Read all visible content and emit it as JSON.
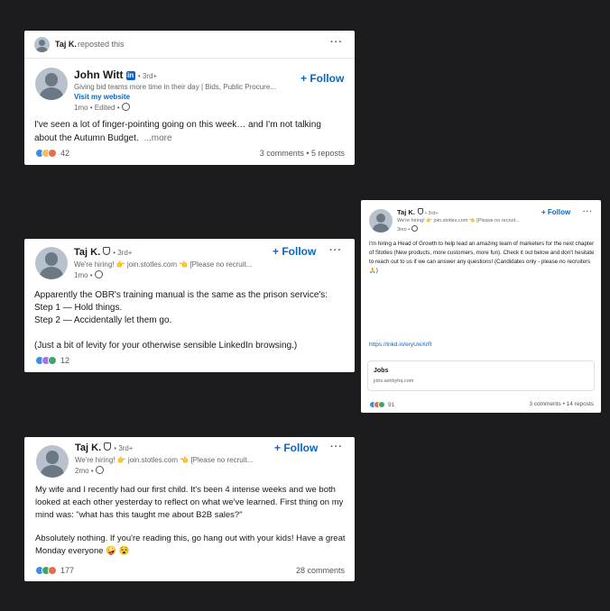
{
  "post1": {
    "repost_user": "Taj K.",
    "repost_text": "reposted this",
    "more": "···",
    "author": "John Witt",
    "degree": "• 3rd+",
    "headline": "Giving bid teams more time in their day | Bids, Public Procure...",
    "website": "Visit my website",
    "meta": "1mo • Edited •",
    "follow": "+ Follow",
    "body": "I've seen a lot of finger-pointing going on this week… and I'm not talking about the Autumn Budget.",
    "see_more": "...more",
    "reaction_count": "42",
    "stats": "3 comments • 5 reposts"
  },
  "post2": {
    "author": "Taj K.",
    "degree": "• 3rd+",
    "headline": "We're hiring! 👉 join.stotles.com 👈 [Please no recruit...",
    "meta": "1mo •",
    "follow": "+ Follow",
    "more": "···",
    "lines": [
      "Apparently the OBR's training manual is the same as the prison service's:",
      "Step 1 — Hold things.",
      "Step 2 — Accidentally let them go.",
      "",
      "(Just a bit of levity for your otherwise sensible LinkedIn browsing.)"
    ],
    "reaction_count": "12"
  },
  "post3": {
    "author": "Taj K.",
    "degree": "• 3rd+",
    "headline": "We're hiring! 👉 join.stotles.com 👈 [Please no recruit...",
    "meta": "2mo •",
    "follow": "+ Follow",
    "more": "···",
    "body1": "My wife and I recently had our first child. It's been 4 intense weeks and we both looked at each other yesterday to reflect on what we've learned. First thing on my mind was: \"what has this taught me about B2B sales?\"",
    "body2": "Absolutely nothing. If you're reading this, go hang out with your kids! Have a great Monday everyone 🤪 😵",
    "reaction_count": "177",
    "stats": "28 comments"
  },
  "post4": {
    "author": "Taj K.",
    "degree": "• 3rd+",
    "headline": "We're hiring! 👉 join.stotles.com 👈 [Please no recruit...",
    "meta": "3mo •",
    "follow": "+ Follow",
    "more": "···",
    "body": "I'm hiring a Head of Growth to help lead an amazing team of marketers for the next chapter of Stotles (New products, more customers, more fun). Check it out below and don't hesitate to reach out to us if we can answer any questions! (Candidates only - please no recruiters 🙏)",
    "link": "https://lnkd.in/eryUwXrR",
    "jobs_title": "Jobs",
    "jobs_domain": "jobs.ashbyhq.com",
    "reaction_count": "91",
    "stats": "3 comments • 14 reposts"
  },
  "colors": {
    "background": "#1c1c1e",
    "link_blue": "#0a66c2",
    "like_blue": "#378fe9",
    "celebrate_green": "#44a36a",
    "love_red": "#df704d",
    "support_purple": "#a872e8",
    "insight_yellow": "#f5bb5c"
  }
}
